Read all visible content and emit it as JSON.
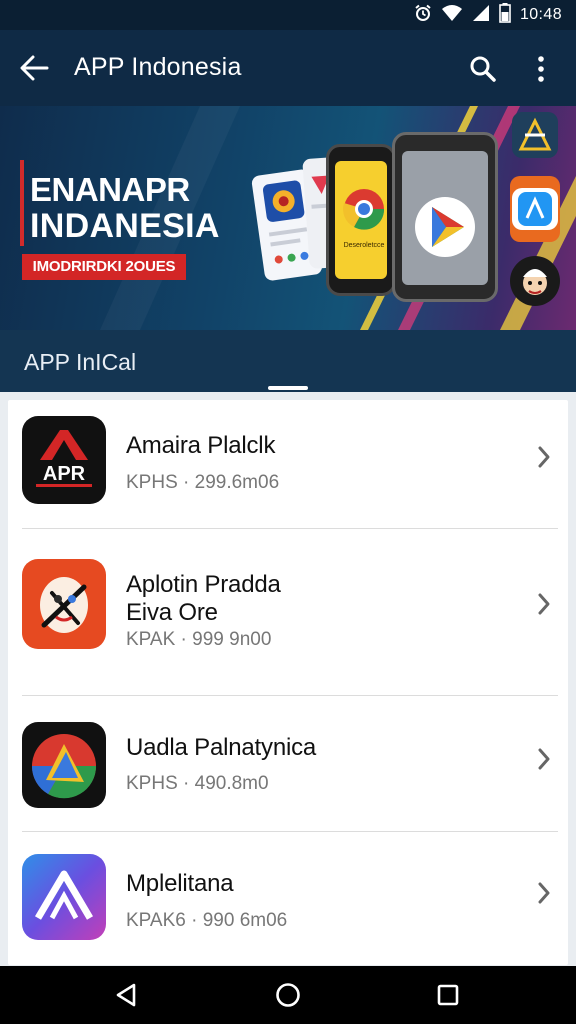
{
  "status_bar": {
    "time": "10:48",
    "icons": [
      "alarm-icon",
      "wifi-icon",
      "signal-icon",
      "battery-icon"
    ]
  },
  "app_bar": {
    "title": "APP Indonesia",
    "icons": [
      "back-arrow-icon",
      "search-icon",
      "more-vert-icon"
    ]
  },
  "banner": {
    "heading_line1": "ENANAPR",
    "heading_line2": "INDANESIA",
    "tag": "IMODRIRDKI 2OUES",
    "phone_caption": "Deseroletcce"
  },
  "section": {
    "title": "APP InICal"
  },
  "apps": [
    {
      "name": "Amaira Plalclk",
      "meta": "KPHS · 299.6m06",
      "icon_text": "APR",
      "icon": "apr-logo-icon"
    },
    {
      "name": "Aplotin Pradda\nEiva Ore",
      "meta": "KPAK · 999 9n00",
      "icon": "mascot-logo-icon"
    },
    {
      "name": "Uadla Palnatynica",
      "meta": "KPHS · 490.8m0",
      "icon": "triangle-logo-icon"
    },
    {
      "name": "Mplelitana",
      "meta": "KPAK6 · 990 6m06",
      "icon": "a-logo-icon"
    }
  ],
  "colors": {
    "app_bar": "#0f2a45",
    "banner_accent": "#d32626",
    "list_bg": "#ffffff"
  },
  "nav_bar": {
    "icons": [
      "back-triangle-icon",
      "home-circle-icon",
      "recents-square-icon"
    ]
  }
}
